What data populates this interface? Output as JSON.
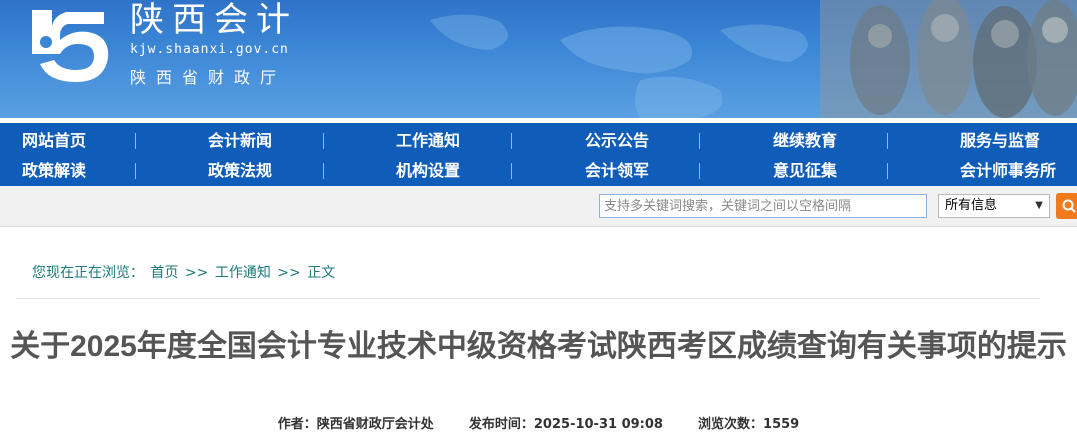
{
  "header": {
    "site_title": "陕西会计",
    "site_domain": "kjw.shaanxi.gov.cn",
    "department": "陕西省财政厅"
  },
  "nav": {
    "row1": [
      "网站首页",
      "会计新闻",
      "工作通知",
      "公示公告",
      "继续教育",
      "服务与监督"
    ],
    "row2": [
      "政策解读",
      "政策法规",
      "机构设置",
      "会计领军",
      "意见征集",
      "会计师事务所"
    ]
  },
  "search": {
    "placeholder": "支持多关键词搜索，关键词之间以空格间隔",
    "scope_selected": "所有信息"
  },
  "breadcrumb": {
    "prefix": "您现在正在浏览：",
    "home": "首页",
    "sep": ">>",
    "section": "工作通知",
    "current": "正文"
  },
  "article": {
    "title": "关于2025年度全国会计专业技术中级资格考试陕西考区成绩查询有关事项的提示",
    "author_label": "作者：",
    "author": "陕西省财政厅会计处",
    "published_label": "发布时间：",
    "published": "2025-10-31 09:08",
    "views_label": "浏览次数：",
    "views": "1559"
  },
  "colors": {
    "nav_bg": "#0f5db8",
    "banner_blue": "#3c86d6",
    "breadcrumb_teal": "#1d7a7a",
    "search_button": "#f07a1c"
  }
}
